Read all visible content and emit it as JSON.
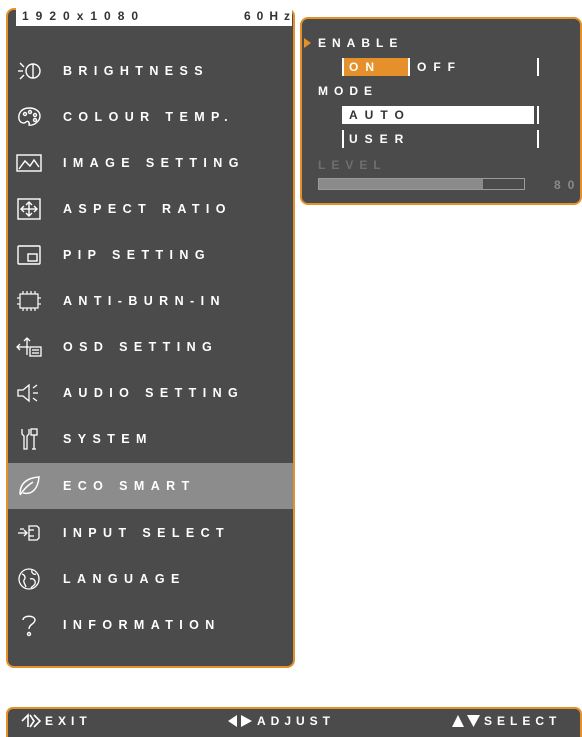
{
  "header": {
    "resolution": "1920x1080",
    "refresh": "60Hz"
  },
  "menu": {
    "items": [
      {
        "label": "BRIGHTNESS",
        "icon": "brightness-icon",
        "selected": false
      },
      {
        "label": "COLOUR TEMP.",
        "icon": "palette-icon",
        "selected": false
      },
      {
        "label": "IMAGE SETTING",
        "icon": "image-icon",
        "selected": false
      },
      {
        "label": "ASPECT RATIO",
        "icon": "aspect-ratio-icon",
        "selected": false
      },
      {
        "label": "PIP SETTING",
        "icon": "pip-icon",
        "selected": false
      },
      {
        "label": "ANTI-BURN-IN",
        "icon": "chip-icon",
        "selected": false
      },
      {
        "label": "OSD SETTING",
        "icon": "osd-icon",
        "selected": false
      },
      {
        "label": "AUDIO SETTING",
        "icon": "speaker-icon",
        "selected": false
      },
      {
        "label": "SYSTEM",
        "icon": "tools-icon",
        "selected": false
      },
      {
        "label": "ECO SMART",
        "icon": "leaf-icon",
        "selected": true
      },
      {
        "label": "INPUT SELECT",
        "icon": "input-icon",
        "selected": false
      },
      {
        "label": "LANGUAGE",
        "icon": "globe-icon",
        "selected": false
      },
      {
        "label": "INFORMATION",
        "icon": "question-icon",
        "selected": false
      }
    ]
  },
  "submenu": {
    "enable_label": "ENABLE",
    "enable_on": "ON",
    "enable_off": "OFF",
    "mode_label": "MODE",
    "mode_auto": "AUTO",
    "mode_user": "USER",
    "level_label": "LEVEL",
    "level_value": "80",
    "level_fraction": 0.8
  },
  "footer": {
    "exit": "EXIT",
    "adjust": "ADJUST",
    "select": "SELECT"
  },
  "colors": {
    "accent": "#e5902a",
    "panel": "#4b4b4b",
    "selected": "#8c8c8c"
  }
}
